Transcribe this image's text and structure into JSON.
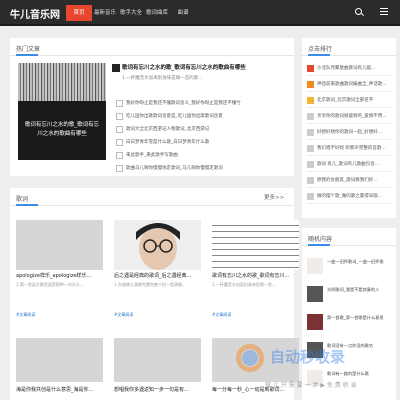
{
  "site": {
    "logo": "牛儿音乐网"
  },
  "nav": {
    "items": [
      "首页",
      "最新音乐",
      "歌手大全",
      "歌词曲库",
      "曲谱"
    ]
  },
  "hot": {
    "title": "热门文章",
    "feature_caption": "歌词有忘川之水的歌_歌词有忘川之水的歌曲有哪些",
    "headline": "歌词有忘川之水的歌_歌词有忘川之水的歌曲有哪些",
    "headline_sub": "1.一杯魔音水加离别滋味是哪一首的歌...",
    "list": [
      "我好你呀止是我还不懂歌词含义_我好你呀止是我还不懂兮",
      "吃儿国你出歌歌词含意是_吃儿国你出歌歌词含意",
      "歌词大全北京西游记人物歌词_北京西游记",
      "白日梦青年雪是什么歌_白日梦青年什么歌",
      "来此歌手_来此歌手写歌曲",
      "歌曲马儿啊你慢慢地走歌词_马儿啊你慢慢走歌词"
    ]
  },
  "lyrics": {
    "title": "歌词",
    "more": "更多>>",
    "items": [
      {
        "title": "apologize样乐_apologize样乐...",
        "desc": "1.第一首英文歌里面是那种一句开头...",
        "tag": "#文章阅读"
      },
      {
        "title": "后之遇是经典的歌词_后之遇经典...",
        "desc": "1.东施赫之演唱专题完善介绍一首演唱...",
        "tag": "#文章阅读"
      },
      {
        "title": "歌词有忘川之水的歌_歌词有忘川...",
        "desc": "1.一杯魔音水加离别滋味是哪一首...",
        "tag": "#文章阅读"
      },
      {
        "title": "",
        "desc": "",
        "tag": ""
      },
      {
        "title": "海是你我共创是什么意思_海是你...",
        "desc": "",
        "tag": ""
      },
      {
        "title": "想唱我你多遇返知一步一句是有...",
        "desc": "",
        "tag": ""
      },
      {
        "title": "每一分每一秒_心一动是到歌词...",
        "desc": "",
        "tag": ""
      },
      {
        "title": "",
        "desc": "",
        "tag": ""
      }
    ]
  },
  "ranking": {
    "title": "点击排行",
    "items": [
      "沙北队月聚歌曲歌词有儿能...",
      "神话前来歌曲歌词编曲全_神话歌...",
      "北京歌词_北京歌词全部名字",
      "亲亲你的歌词很能够的_爱情不用...",
      "好想好想你的歌词一起_好想好...",
      "我们唱不好呢 听那声完整的首歌...",
      "歌词 有儿_歌词有儿歌曲包含...",
      "原我的女朋友_歌词教我们好...",
      "做的摆个歌_做的歌之曼得早版..."
    ]
  },
  "random": {
    "title": "随机内容",
    "items": [
      "一曲一旧怀歌词_一曲一旧怀歌",
      "光明歌词_我是不是寂寞的人",
      "第一首歌_第一首歌是什么意思",
      "歌词没有一点你没的歌名",
      "歌词有一路的是什么歌"
    ]
  },
  "watermark": {
    "text": "自动秒收录",
    "sub": "做 让 只 需 要 一 步 ▶ 免 费 收 录"
  }
}
